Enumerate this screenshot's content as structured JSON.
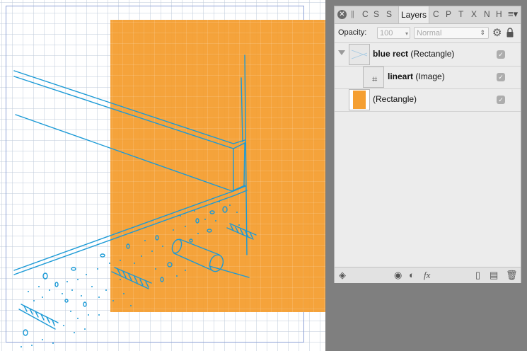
{
  "canvas": {
    "colors": {
      "orange": "#f59f31",
      "lineart": "#1b9ad6",
      "page_border": "#8da1d6"
    }
  },
  "panel": {
    "tabs": [
      "C",
      "S",
      "S",
      "Layers",
      "C",
      "P",
      "T",
      "X",
      "N",
      "H"
    ],
    "active_tab": "Layers",
    "opacity": {
      "label": "Opacity:",
      "value": "100"
    },
    "blend_mode": "Normal",
    "layers": [
      {
        "name": "blue rect",
        "type": "(Rectangle)",
        "visible": true,
        "expanded": true
      },
      {
        "name": "lineart",
        "type": "(Image)",
        "visible": true,
        "child": true
      },
      {
        "name": "",
        "type": "(Rectangle)",
        "visible": true
      }
    ]
  },
  "icons": {
    "close": "close-icon",
    "settings": "gear-icon",
    "lock": "lock-icon",
    "layers_panel": "layers-stack-icon",
    "mask": "mask-icon",
    "adjustment": "adjustment-icon",
    "fx": "fx-icon",
    "add_layer": "add-layer-icon",
    "add_pixel_layer": "add-pixel-layer-icon",
    "delete": "trash-icon",
    "menu": "panel-menu-icon"
  }
}
